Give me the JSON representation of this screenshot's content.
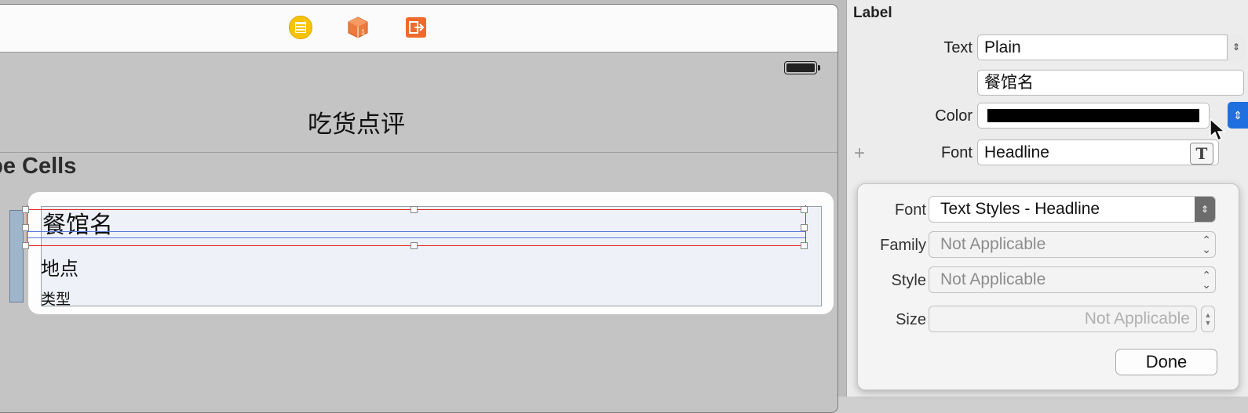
{
  "canvas": {
    "nav_title": "吃货点评",
    "section_header": "ype Cells",
    "cell": {
      "name_label": "餐馆名",
      "location_label": "地点",
      "type_label": "类型"
    },
    "dock_icons": [
      "view-controller-icon",
      "first-responder-icon",
      "exit-icon"
    ]
  },
  "inspector": {
    "section_title": "Label",
    "text": {
      "label": "Text",
      "value": "Plain",
      "content": "餐馆名"
    },
    "color": {
      "label": "Color",
      "value": "#000000"
    },
    "font": {
      "label": "Font",
      "value": "Headline"
    }
  },
  "font_popover": {
    "font": {
      "label": "Font",
      "value": "Text Styles - Headline"
    },
    "family": {
      "label": "Family",
      "value": "Not Applicable"
    },
    "style": {
      "label": "Style",
      "value": "Not Applicable"
    },
    "size": {
      "label": "Size",
      "value": "Not Applicable"
    },
    "done_label": "Done"
  },
  "colors": {
    "selection_red": "#e0281e",
    "baseline_blue": "#5a7be0",
    "accent_blue": "#1f6fe0"
  }
}
